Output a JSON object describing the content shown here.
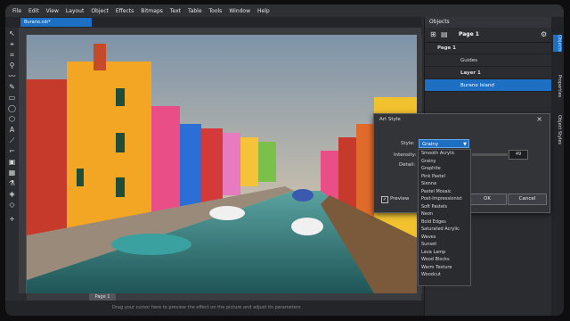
{
  "menu": [
    "File",
    "Edit",
    "View",
    "Layout",
    "Object",
    "Effects",
    "Bitmaps",
    "Text",
    "Table",
    "Tools",
    "Window",
    "Help"
  ],
  "document_tab": "Burano.cdr*",
  "page_tab": "Page 1",
  "status_text": "Drag your cursor here to preview the effect on the picture and adjust its parameters",
  "objects_panel": {
    "title": "Objects",
    "page_label": "Page 1",
    "rows": [
      {
        "label": "Page 1"
      },
      {
        "label": "Guides"
      },
      {
        "label": "Layer 1"
      },
      {
        "label": "Burano Island"
      }
    ]
  },
  "side_tabs": [
    "Objects",
    "Properties",
    "Object Styles"
  ],
  "dialog": {
    "title": "Art Style",
    "close": "×",
    "style_label": "Style:",
    "style_value": "Grainy",
    "intensity_label": "Intensity:",
    "intensity_value": "49",
    "detail_label": "Detail:",
    "preview_label": "Preview",
    "ok_label": "OK",
    "cancel_label": "Cancel"
  },
  "style_options": [
    "Smooth Acrylic",
    "Grainy",
    "Graphite",
    "Pink Pastel",
    "Sienna",
    "Pastel Mosaic",
    "Post-Impressionist",
    "Soft Pastels",
    "Neon",
    "Bold Edges",
    "Saturated Acrylic",
    "Waves",
    "Sunset",
    "Lava Lamp",
    "Wood Blocks",
    "Warm Texture",
    "Woodcut"
  ],
  "icons": {
    "close": "close-icon",
    "gear": "gear-icon",
    "arrow": "chevron-down-icon"
  },
  "colors": {
    "accent": "#1d6fc4",
    "panel": "#2b2c30"
  }
}
